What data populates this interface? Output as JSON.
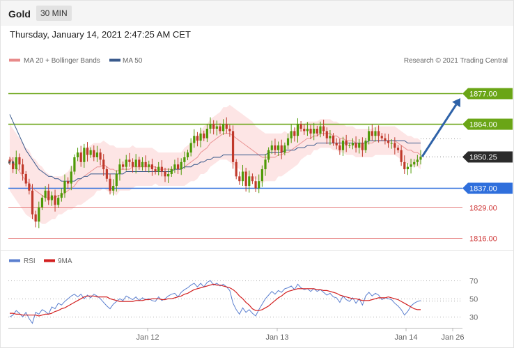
{
  "header": {
    "instrument": "Gold",
    "timeframe": "30 MIN",
    "timestamp": "Thursday, January 14, 2021 2:47:25 AM CET"
  },
  "colors": {
    "bull": "#4e9a06",
    "bear": "#c0392b",
    "ma20": "#e88a8a",
    "ma50": "#3a5a8c",
    "band": "#fde0e0",
    "resistance": "#6aa516",
    "pivot": "#2f6fdc",
    "support": "#e06060",
    "arrow": "#2e62a8",
    "rsi": "#5b7fcf",
    "rsi_ma": "#d21f1f"
  },
  "chart_data": [
    {
      "type": "candlestick",
      "legend": [
        {
          "name": "MA 20 + Bollinger Bands",
          "color": "#e88a8a"
        },
        {
          "name": "MA 50",
          "color": "#3a5a8c"
        }
      ],
      "credit": "Research © 2021 Trading Central",
      "ylim": [
        1812,
        1888
      ],
      "levels": [
        {
          "value": 1877.0,
          "label": "1877.00",
          "kind": "resistance"
        },
        {
          "value": 1864.0,
          "label": "1864.00",
          "kind": "resistance"
        },
        {
          "value": 1837.0,
          "label": "1837.00",
          "kind": "pivot"
        },
        {
          "value": 1829.0,
          "label": "1829.00",
          "kind": "support"
        },
        {
          "value": 1816.0,
          "label": "1816.00",
          "kind": "support"
        }
      ],
      "last_price": {
        "value": 1850.25,
        "label": "1850.25"
      },
      "forecast_target": 1876,
      "close": [
        1848,
        1845,
        1850,
        1847,
        1843,
        1839,
        1836,
        1826,
        1823,
        1829,
        1833,
        1836,
        1832,
        1834,
        1830,
        1833,
        1835,
        1840,
        1839,
        1844,
        1850,
        1852,
        1848,
        1854,
        1851,
        1853,
        1850,
        1852,
        1849,
        1845,
        1841,
        1836,
        1838,
        1843,
        1847,
        1846,
        1849,
        1848,
        1846,
        1849,
        1846,
        1848,
        1846,
        1847,
        1845,
        1844,
        1846,
        1844,
        1842,
        1843,
        1845,
        1847,
        1845,
        1848,
        1850,
        1852,
        1856,
        1859,
        1857,
        1860,
        1858,
        1862,
        1864,
        1862,
        1863,
        1861,
        1864,
        1862,
        1861,
        1848,
        1842,
        1840,
        1844,
        1838,
        1842,
        1840,
        1837,
        1840,
        1845,
        1849,
        1853,
        1855,
        1853,
        1855,
        1852,
        1855,
        1858,
        1861,
        1859,
        1864,
        1862,
        1861,
        1862,
        1860,
        1862,
        1860,
        1863,
        1861,
        1858,
        1859,
        1856,
        1855,
        1853,
        1857,
        1855,
        1855,
        1856,
        1854,
        1856,
        1853,
        1857,
        1861,
        1859,
        1861,
        1859,
        1858,
        1857,
        1856,
        1856,
        1854,
        1853,
        1848,
        1845,
        1846,
        1847,
        1848,
        1849,
        1850.25
      ],
      "ma20": [
        1850,
        1848,
        1846,
        1844,
        1842,
        1840,
        1839,
        1837,
        1836,
        1835,
        1834,
        1833,
        1833,
        1833,
        1833,
        1834,
        1834,
        1835,
        1836,
        1837,
        1838,
        1840,
        1841,
        1842,
        1843,
        1844,
        1845,
        1846,
        1846,
        1847,
        1846,
        1845,
        1845,
        1844,
        1845,
        1845,
        1845,
        1845,
        1846,
        1846,
        1846,
        1846,
        1846,
        1846,
        1846,
        1846,
        1845,
        1845,
        1845,
        1845,
        1845,
        1845,
        1845,
        1845,
        1846,
        1847,
        1848,
        1849,
        1850,
        1852,
        1853,
        1854,
        1856,
        1857,
        1858,
        1859,
        1860,
        1860,
        1860,
        1859,
        1858,
        1857,
        1856,
        1855,
        1854,
        1853,
        1852,
        1851,
        1850,
        1850,
        1850,
        1850,
        1850,
        1851,
        1851,
        1852,
        1852,
        1853,
        1854,
        1855,
        1856,
        1857,
        1858,
        1858,
        1859,
        1859,
        1860,
        1860,
        1860,
        1860,
        1859,
        1859,
        1858,
        1858,
        1857,
        1857,
        1857,
        1856,
        1856,
        1856,
        1856,
        1856,
        1856,
        1857,
        1857,
        1857,
        1857,
        1857,
        1857,
        1857,
        1856,
        1855,
        1854,
        1853,
        1853,
        1852,
        1852,
        1851
      ],
      "band_width": [
        14,
        14,
        14,
        14,
        14,
        14,
        14,
        13,
        13,
        12,
        12,
        11,
        10,
        9,
        9,
        8,
        8,
        8,
        8,
        9,
        9,
        10,
        11,
        11,
        11,
        11,
        11,
        10,
        10,
        10,
        10,
        10,
        10,
        10,
        9,
        9,
        9,
        9,
        9,
        8,
        8,
        8,
        8,
        8,
        8,
        7,
        7,
        7,
        7,
        7,
        7,
        7,
        7,
        7,
        8,
        8,
        8,
        9,
        9,
        9,
        10,
        10,
        10,
        10,
        10,
        10,
        11,
        11,
        12,
        12,
        12,
        12,
        12,
        12,
        12,
        12,
        11,
        11,
        11,
        10,
        10,
        10,
        10,
        9,
        9,
        9,
        8,
        8,
        8,
        8,
        7,
        7,
        7,
        7,
        6,
        6,
        6,
        6,
        6,
        6,
        6,
        6,
        6,
        6,
        6,
        6,
        6,
        6,
        6,
        6,
        6,
        6,
        6,
        6,
        6,
        6,
        6,
        6,
        6,
        6,
        6,
        6,
        6,
        6,
        6,
        6,
        6,
        6
      ],
      "ma50": [
        1868,
        1865,
        1862,
        1859,
        1856,
        1853,
        1851,
        1849,
        1847,
        1845,
        1844,
        1843,
        1842,
        1842,
        1841,
        1841,
        1840,
        1840,
        1840,
        1840,
        1840,
        1841,
        1841,
        1842,
        1842,
        1843,
        1843,
        1843,
        1843,
        1843,
        1843,
        1843,
        1843,
        1843,
        1843,
        1843,
        1844,
        1844,
        1844,
        1844,
        1844,
        1844,
        1844,
        1844,
        1844,
        1844,
        1844,
        1844,
        1844,
        1844,
        1844,
        1845,
        1845,
        1845,
        1846,
        1846,
        1846,
        1847,
        1847,
        1848,
        1848,
        1849,
        1849,
        1850,
        1850,
        1850,
        1851,
        1851,
        1851,
        1851,
        1851,
        1851,
        1851,
        1851,
        1851,
        1851,
        1851,
        1851,
        1851,
        1851,
        1852,
        1852,
        1852,
        1852,
        1852,
        1853,
        1853,
        1853,
        1853,
        1854,
        1854,
        1854,
        1855,
        1855,
        1855,
        1856,
        1856,
        1856,
        1856,
        1856,
        1856,
        1856,
        1856,
        1856,
        1856,
        1856,
        1856,
        1856,
        1856,
        1856,
        1856,
        1857,
        1857,
        1857,
        1857,
        1857,
        1857,
        1857,
        1857,
        1857,
        1857,
        1857,
        1857,
        1856,
        1856,
        1856,
        1856,
        1856
      ]
    },
    {
      "type": "line",
      "legend": [
        {
          "name": "RSI",
          "color": "#5b7fcf"
        },
        {
          "name": "9MA",
          "color": "#d21f1f"
        }
      ],
      "ylim": [
        18,
        80
      ],
      "y_ticks": [
        "70",
        "50",
        "30"
      ],
      "y_tick_values": [
        70,
        50,
        30
      ],
      "x_ticks": [
        "Jan 12",
        "Jan 13",
        "Jan 14",
        "Jan 26"
      ],
      "rsi": [
        30,
        32,
        37,
        34,
        30,
        35,
        28,
        23,
        35,
        33,
        38,
        36,
        33,
        41,
        39,
        45,
        43,
        47,
        50,
        53,
        55,
        52,
        55,
        50,
        54,
        51,
        55,
        53,
        50,
        46,
        42,
        39,
        44,
        47,
        50,
        48,
        53,
        51,
        49,
        52,
        48,
        51,
        49,
        50,
        48,
        47,
        52,
        48,
        50,
        53,
        55,
        56,
        52,
        57,
        60,
        62,
        65,
        67,
        63,
        67,
        63,
        68,
        70,
        65,
        67,
        64,
        66,
        63,
        59,
        45,
        38,
        33,
        40,
        35,
        38,
        34,
        31,
        38,
        44,
        50,
        54,
        58,
        55,
        59,
        57,
        61,
        62,
        64,
        60,
        66,
        62,
        60,
        61,
        58,
        61,
        58,
        60,
        57,
        54,
        56,
        52,
        51,
        46,
        53,
        49,
        47,
        51,
        45,
        50,
        43,
        53,
        57,
        53,
        56,
        54,
        49,
        51,
        50,
        49,
        45,
        42,
        38,
        32,
        36,
        42,
        45,
        47,
        48
      ],
      "ma9": [
        34,
        34,
        33,
        33,
        32,
        32,
        32,
        32,
        32,
        31,
        32,
        33,
        33,
        34,
        36,
        37,
        39,
        40,
        42,
        44,
        46,
        48,
        50,
        52,
        53,
        53,
        53,
        52,
        52,
        52,
        52,
        50,
        49,
        48,
        47,
        47,
        47,
        47,
        47,
        48,
        48,
        48,
        49,
        49,
        50,
        50,
        50,
        49,
        49,
        50,
        50,
        51,
        52,
        53,
        55,
        56,
        58,
        60,
        61,
        62,
        63,
        64,
        65,
        66,
        65,
        65,
        64,
        63,
        62,
        60,
        57,
        53,
        50,
        46,
        43,
        39,
        37,
        37,
        38,
        40,
        42,
        45,
        48,
        51,
        53,
        56,
        58,
        59,
        60,
        61,
        61,
        61,
        61,
        61,
        61,
        60,
        60,
        59,
        59,
        58,
        57,
        56,
        54,
        53,
        52,
        51,
        50,
        50,
        49,
        48,
        48,
        48,
        49,
        50,
        51,
        51,
        51,
        52,
        51,
        50,
        49,
        47,
        45,
        43,
        41,
        39,
        38,
        38
      ]
    }
  ]
}
